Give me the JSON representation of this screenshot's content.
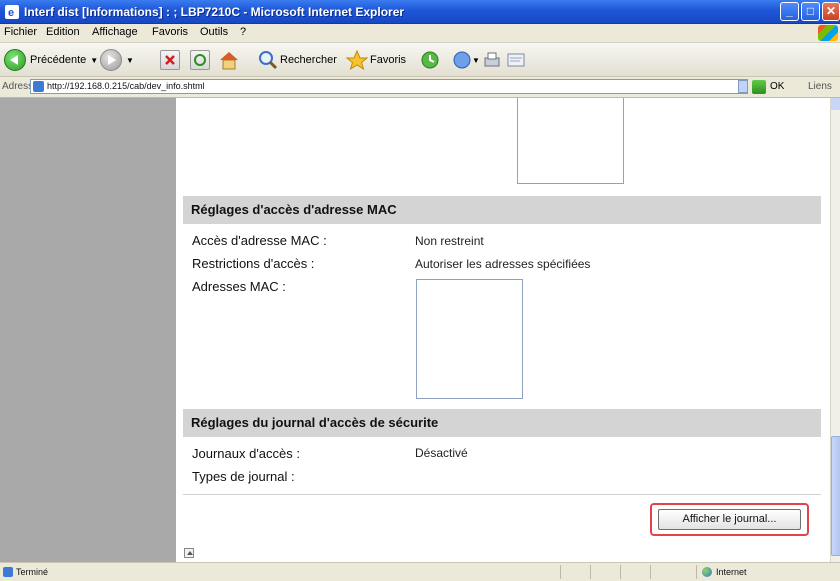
{
  "window": {
    "title": "Interf dist [Informations] : ; LBP7210C - Microsoft Internet Explorer",
    "min_label": "_",
    "max_label": "□",
    "close_label": "✕"
  },
  "menu": {
    "items": [
      "Fichier",
      "Edition",
      "Affichage",
      "Favoris",
      "Outils",
      "?"
    ]
  },
  "toolbar": {
    "back_label": "Précédente",
    "search_label": "Rechercher",
    "favorites_label": "Favoris"
  },
  "address": {
    "label": "Adresse",
    "url": "http://192.168.0.215/cab/dev_info.shtml",
    "go_label": "OK",
    "links_label": "Liens"
  },
  "mac_section": {
    "header": "Réglages d'accès d'adresse MAC",
    "rows": [
      {
        "label": "Accès d'adresse MAC :",
        "value": "Non restreint"
      },
      {
        "label": "Restrictions d'accès :",
        "value": "Autoriser les adresses spécifiées"
      },
      {
        "label": "Adresses MAC :",
        "value": ""
      }
    ]
  },
  "log_section": {
    "header": "Réglages du journal d'accès de sécurite",
    "rows": [
      {
        "label": "Journaux d'accès :",
        "value": "Désactivé"
      },
      {
        "label": "Types de journal :",
        "value": ""
      }
    ]
  },
  "buttons": {
    "show_log": "Afficher le journal..."
  },
  "status": {
    "text": "Terminé",
    "zone": "Internet"
  },
  "colors": {
    "highlight_border": "#E2444C",
    "section_header_bg": "#D4D4D4",
    "nav_bg": "#A9A9A9"
  }
}
